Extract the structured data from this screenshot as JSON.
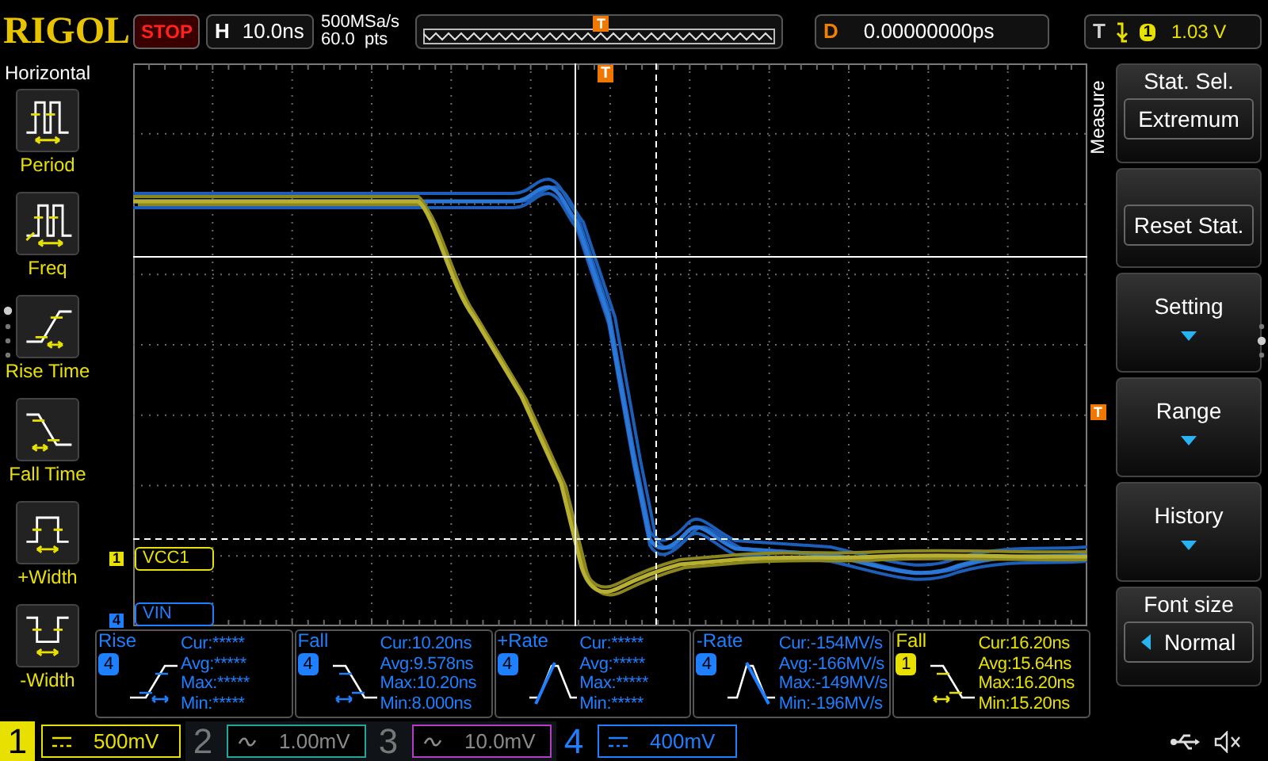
{
  "top_bar": {
    "brand": "RIGOL",
    "run_state": "STOP",
    "horizontal": {
      "label": "H",
      "timebase": "10.0ns"
    },
    "sample_rate": "500MSa/s",
    "memory_depth": "60.0  pts",
    "memory_marker": "T",
    "delay": {
      "label": "D",
      "value": "0.00000000ps"
    },
    "trigger": {
      "label": "T",
      "source": "1",
      "level": "1.03 V"
    }
  },
  "left_menu": {
    "title": "Horizontal",
    "items": [
      {
        "kind": "period",
        "label": "Period"
      },
      {
        "kind": "freq",
        "label": "Freq"
      },
      {
        "kind": "rise",
        "label": "Rise Time"
      },
      {
        "kind": "fall",
        "label": "Fall Time"
      },
      {
        "kind": "pwidth",
        "label": "+Width"
      },
      {
        "kind": "nwidth",
        "label": "-Width"
      }
    ]
  },
  "screen": {
    "trigger_time_marker": "T",
    "trigger_level_marker": "T",
    "channel_tags": [
      {
        "channel": "1",
        "name": "VCC1",
        "color": "#e8e000"
      },
      {
        "channel": "4",
        "name": "VIN",
        "color": "#1e7fff"
      }
    ]
  },
  "measurements": [
    {
      "name": "Rise",
      "channel": "4",
      "kind": "rise",
      "color": "#1e7fff",
      "stats": [
        {
          "label": "Cur:",
          "value": "*****"
        },
        {
          "label": "Avg:",
          "value": "*****"
        },
        {
          "label": "Max:",
          "value": "*****"
        },
        {
          "label": "Min:",
          "value": "*****"
        }
      ]
    },
    {
      "name": "Fall",
      "channel": "4",
      "kind": "fall",
      "color": "#1e7fff",
      "stats": [
        {
          "label": "Cur:",
          "value": "10.20ns"
        },
        {
          "label": "Avg:",
          "value": "9.578ns"
        },
        {
          "label": "Max:",
          "value": "10.20ns"
        },
        {
          "label": "Min:",
          "value": "8.000ns"
        }
      ]
    },
    {
      "name": "+Rate",
      "channel": "4",
      "kind": "prate",
      "color": "#1e7fff",
      "stats": [
        {
          "label": "Cur:",
          "value": "*****"
        },
        {
          "label": "Avg:",
          "value": "*****"
        },
        {
          "label": "Max:",
          "value": "*****"
        },
        {
          "label": "Min:",
          "value": "*****"
        }
      ]
    },
    {
      "name": "-Rate",
      "channel": "4",
      "kind": "nrate",
      "color": "#1e7fff",
      "stats": [
        {
          "label": "Cur:",
          "value": "-154MV/s"
        },
        {
          "label": "Avg:",
          "value": "-166MV/s"
        },
        {
          "label": "Max:",
          "value": "-149MV/s"
        },
        {
          "label": "Min:",
          "value": "-196MV/s"
        }
      ]
    },
    {
      "name": "Fall",
      "channel": "1",
      "kind": "fall",
      "color": "#e8e000",
      "stats": [
        {
          "label": "Cur:",
          "value": "16.20ns"
        },
        {
          "label": "Avg:",
          "value": "15.64ns"
        },
        {
          "label": "Max:",
          "value": "16.20ns"
        },
        {
          "label": "Min:",
          "value": "15.20ns"
        }
      ]
    }
  ],
  "right_menu": {
    "title": "Measure",
    "buttons": [
      {
        "kind": "value",
        "label": "Stat. Sel.",
        "value": "Extremum"
      },
      {
        "kind": "action",
        "value": "Reset Stat."
      },
      {
        "kind": "submenu",
        "label": "Setting"
      },
      {
        "kind": "submenu",
        "label": "Range"
      },
      {
        "kind": "submenu",
        "label": "History"
      },
      {
        "kind": "cycle",
        "label": "Font size",
        "value": "Normal"
      }
    ]
  },
  "channels": [
    {
      "number": "1",
      "kind": "dc",
      "scale": "500mV",
      "enabled": true,
      "selected": true,
      "color": "#e8e000"
    },
    {
      "number": "2",
      "kind": "ac",
      "scale": "1.00mV",
      "enabled": false,
      "selected": false,
      "color": "#1fa89a"
    },
    {
      "number": "3",
      "kind": "ac",
      "scale": "10.0mV",
      "enabled": false,
      "selected": false,
      "color": "#b43cc8"
    },
    {
      "number": "4",
      "kind": "dc",
      "scale": "400mV",
      "enabled": true,
      "selected": false,
      "color": "#1e7fff"
    }
  ]
}
